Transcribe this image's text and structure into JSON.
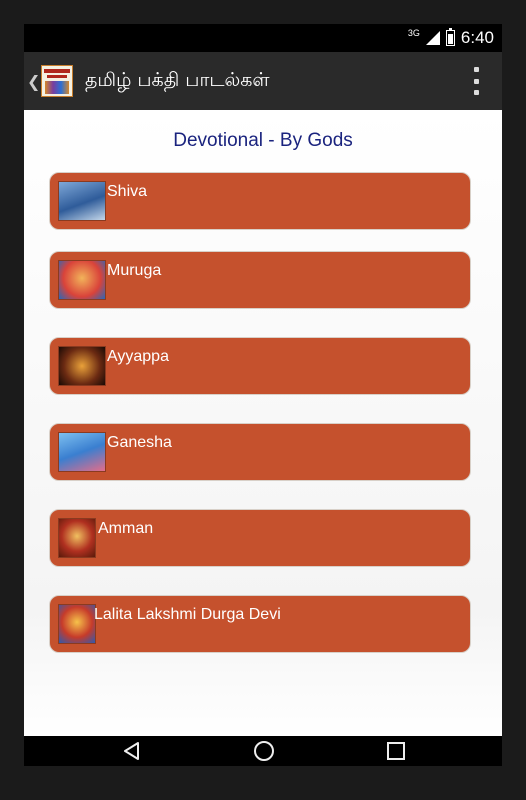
{
  "status": {
    "network": "3G",
    "time": "6:40"
  },
  "actionbar": {
    "title": "தமிழ் பக்தி பாடல்கள்",
    "up_icon": "chevron-left-icon",
    "menu_icon": "overflow-menu-icon"
  },
  "main": {
    "heading": "Devotional - By Gods"
  },
  "gods": [
    {
      "label": "Shiva",
      "icon": "shiva-thumbnail"
    },
    {
      "label": "Muruga",
      "icon": "muruga-thumbnail"
    },
    {
      "label": "Ayyappa",
      "icon": "ayyappa-thumbnail"
    },
    {
      "label": "Ganesha",
      "icon": "ganesha-thumbnail"
    },
    {
      "label": "Amman",
      "icon": "amman-thumbnail"
    },
    {
      "label": "Lalita Lakshmi Durga Devi",
      "icon": "devi-thumbnail"
    }
  ],
  "navbar": {
    "back_icon": "back-icon",
    "home_icon": "home-icon",
    "recents_icon": "recents-icon"
  },
  "colors": {
    "row_bg": "#c5512d",
    "heading": "#1a237e",
    "actionbar": "#2a2a2a"
  }
}
